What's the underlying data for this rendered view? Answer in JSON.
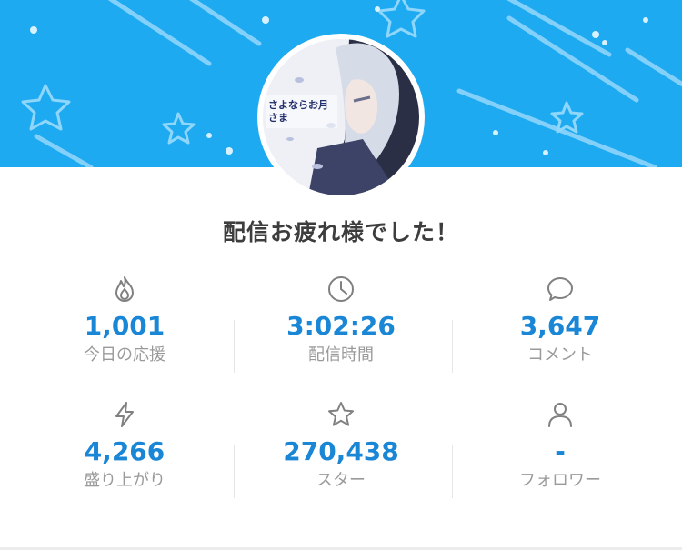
{
  "header": {
    "banner_color": "#1eaaf1",
    "avatar_caption": "さよならお月さま"
  },
  "title": "配信お疲れ様でした！",
  "accent_color": "#1a86d6",
  "stats": [
    {
      "icon": "flame-icon",
      "value": "1,001",
      "label": "今日の応援"
    },
    {
      "icon": "clock-icon",
      "value": "3:02:26",
      "label": "配信時間"
    },
    {
      "icon": "comment-icon",
      "value": "3,647",
      "label": "コメント"
    },
    {
      "icon": "lightning-icon",
      "value": "4,266",
      "label": "盛り上がり"
    },
    {
      "icon": "star-icon",
      "value": "270,438",
      "label": "スター"
    },
    {
      "icon": "user-icon",
      "value": "-",
      "label": "フォロワー"
    }
  ]
}
